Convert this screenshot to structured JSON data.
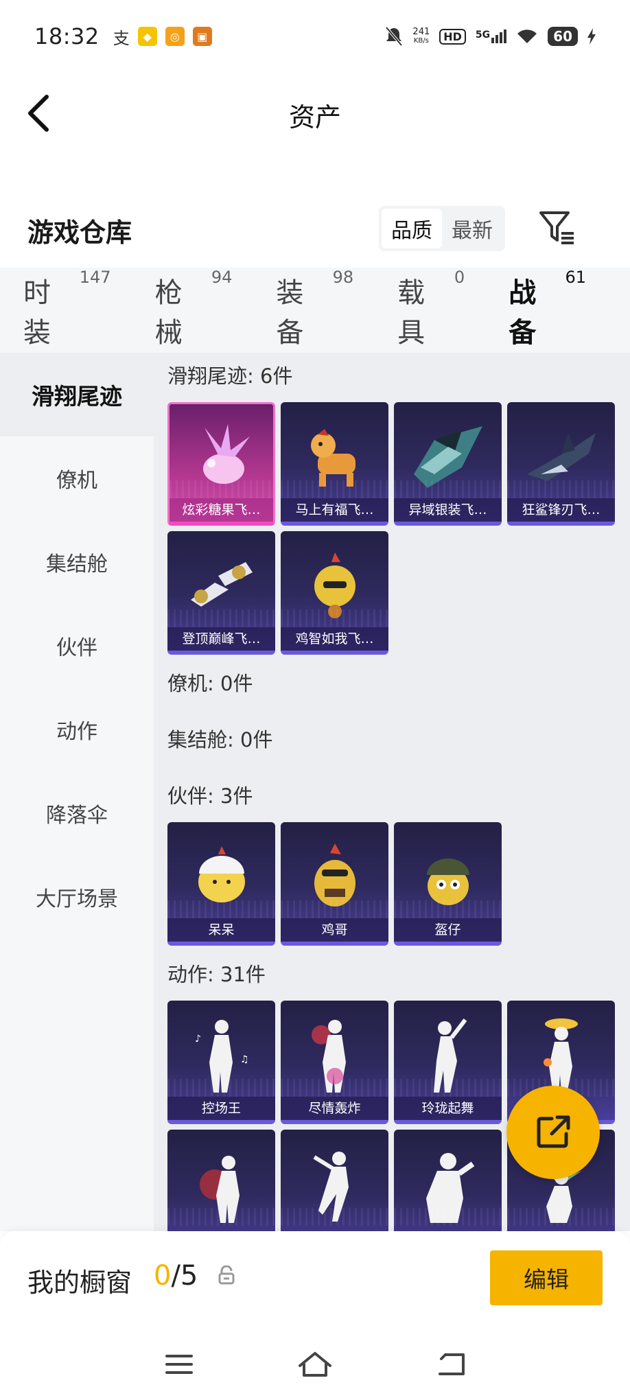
{
  "status_bar": {
    "time": "18:32",
    "net_speed_value": "241",
    "net_speed_unit": "KB/s",
    "hd": "HD",
    "net": "5G",
    "battery": "60"
  },
  "header": {
    "title": "资产"
  },
  "warehouse": {
    "title": "游戏仓库",
    "sort_options": [
      "品质",
      "最新"
    ],
    "active_sort": "品质"
  },
  "categories": [
    {
      "name": "时装",
      "count": "147"
    },
    {
      "name": "枪械",
      "count": "94"
    },
    {
      "name": "装备",
      "count": "98"
    },
    {
      "name": "载具",
      "count": "0"
    },
    {
      "name": "战备",
      "count": "61"
    }
  ],
  "active_category": "战备",
  "side_nav": {
    "items": [
      "滑翔尾迹",
      "僚机",
      "集结舱",
      "伙伴",
      "动作",
      "降落伞",
      "大厅场景"
    ],
    "active": "滑翔尾迹"
  },
  "sections": {
    "trails": {
      "label": "滑翔尾迹: 6件",
      "items": [
        "炫彩糖果飞…",
        "马上有福飞…",
        "异域银装飞…",
        "狂鲨锋刃飞…",
        "登顶巅峰飞…",
        "鸡智如我飞…"
      ]
    },
    "wingman": {
      "label": "僚机: 0件"
    },
    "pod": {
      "label": "集结舱: 0件"
    },
    "partners": {
      "label": "伙伴: 3件",
      "items": [
        "呆呆",
        "鸡哥",
        "盔仔"
      ]
    },
    "emotes": {
      "label": "动作: 31件",
      "items": [
        "控场王",
        "尽情轰炸",
        "玲珑起舞",
        "",
        "",
        "",
        "",
        ""
      ]
    }
  },
  "bottom": {
    "label": "我的橱窗",
    "count_current": "0",
    "count_total": "/5",
    "edit_label": "编辑"
  },
  "colors": {
    "accent": "#f6b400",
    "card_purple": "#2f2a5e",
    "card_pink": "#c2409e"
  }
}
